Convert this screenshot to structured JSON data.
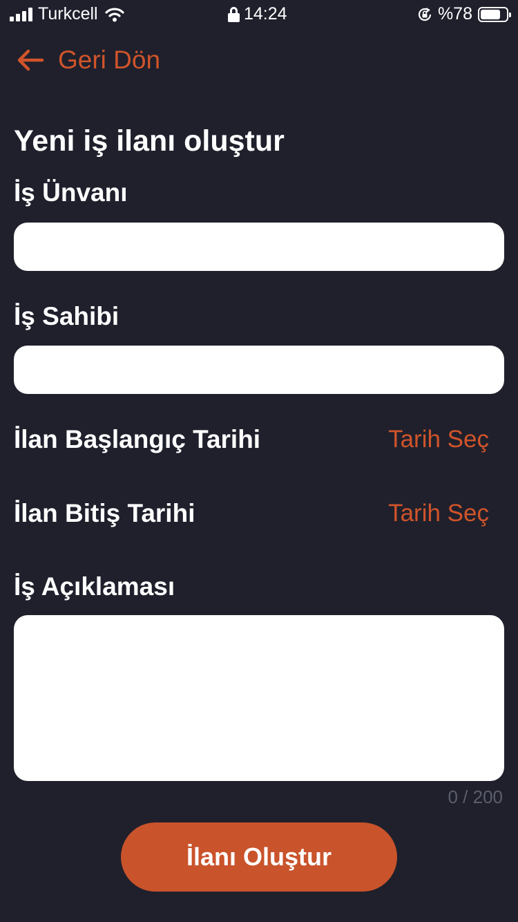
{
  "status_bar": {
    "carrier": "Turkcell",
    "time": "14:24",
    "battery": "%78",
    "battery_level": 0.78,
    "icons": [
      "signal-icon",
      "wifi-icon",
      "lock-icon",
      "rotation-lock-icon",
      "battery-icon"
    ]
  },
  "nav": {
    "back_label": "Geri Dön"
  },
  "form": {
    "title": "Yeni iş ilanı oluştur",
    "job_title_label": "İş Ünvanı",
    "job_title_value": "",
    "employer_label": "İş Sahibi",
    "employer_value": "",
    "start_date_label": "İlan Başlangıç Tarihi",
    "start_date_action": "Tarih Seç",
    "end_date_label": "İlan Bitiş Tarihi",
    "end_date_action": "Tarih Seç",
    "description_label": "İş Açıklaması",
    "description_value": "",
    "counter": "0 / 200",
    "submit_label": "İlanı Oluştur"
  },
  "colors": {
    "background": "#1f202c",
    "accent": "#d0542a",
    "button": "#c9532b",
    "counter": "#5b5e6c"
  }
}
